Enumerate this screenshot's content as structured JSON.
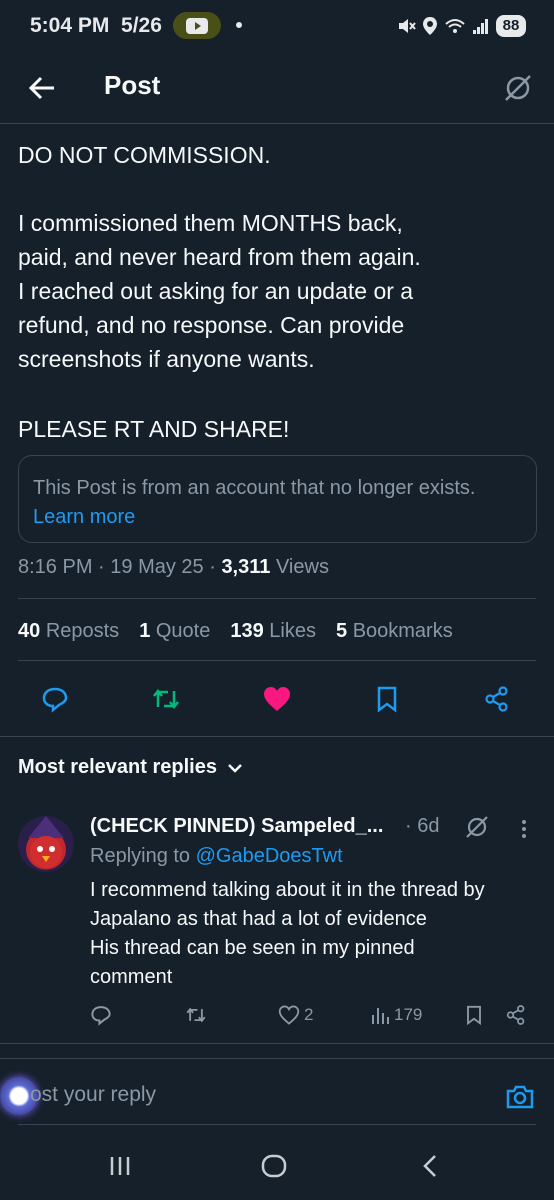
{
  "status_bar": {
    "time": "5:04 PM",
    "date": "5/26",
    "battery": "88"
  },
  "header": {
    "title": "Post"
  },
  "post": {
    "line1": "DO NOT COMMISSION.",
    "line2": "I commissioned them MONTHS back,",
    "line3": "paid, and never heard from them again.",
    "line4": "I reached out asking for an update or a",
    "line5": "refund, and no response. Can provide",
    "line6": "screenshots if anyone wants.",
    "line7": "PLEASE RT AND SHARE!",
    "notice_text": "This Post is from an account that no longer exists.",
    "notice_link": "Learn more",
    "time": "8:16 PM",
    "date": "19 May 25",
    "views_count": "3,311",
    "views_label": "Views",
    "stats": {
      "reposts_count": "40",
      "reposts_label": "Reposts",
      "quotes_count": "1",
      "quotes_label": "Quote",
      "likes_count": "139",
      "likes_label": "Likes",
      "bookmarks_count": "5",
      "bookmarks_label": "Bookmarks"
    },
    "liked": true,
    "colors": {
      "like": "#f91880",
      "repost": "#00ba7c",
      "link": "#1d9bf0"
    }
  },
  "replies": {
    "section_title": "Most relevant replies",
    "items": [
      {
        "name": "(CHECK PINNED) Sampeled_...",
        "time": "6d",
        "replying_label": "Replying to",
        "replying_handle": "@GabeDoesTwt",
        "body_line1": "I recommend talking about it in the thread by",
        "body_line2": "Japalano as that had a lot of evidence",
        "body_line3": "His thread can be seen in my pinned",
        "body_line4": "comment",
        "likes": "2",
        "views": "179"
      }
    ]
  },
  "compose": {
    "placeholder": "ost your reply"
  }
}
